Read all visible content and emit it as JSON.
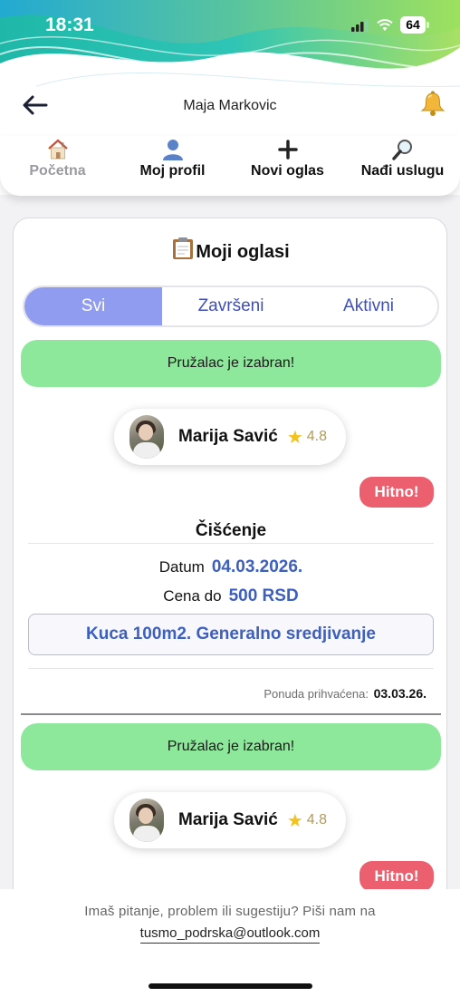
{
  "status_bar": {
    "time": "18:31",
    "battery": "64"
  },
  "header": {
    "user_name": "Maja Markovic"
  },
  "nav": {
    "items": [
      {
        "label": "Početna",
        "icon": "house-icon"
      },
      {
        "label": "Moj profil",
        "icon": "person-icon"
      },
      {
        "label": "Novi oglas",
        "icon": "plus-icon"
      },
      {
        "label": "Nađi uslugu",
        "icon": "magnifier-icon"
      }
    ]
  },
  "card": {
    "title": "Moji oglasi",
    "tabs": [
      {
        "label": "Svi",
        "active": true
      },
      {
        "label": "Završeni",
        "active": false
      },
      {
        "label": "Aktivni",
        "active": false
      }
    ],
    "listings": [
      {
        "status": "Pružalac je izabran!",
        "provider": {
          "name": "Marija Savić",
          "rating": "4.8"
        },
        "urgent": "Hitno!",
        "service": "Čišćenje",
        "date_label": "Datum",
        "date": "04.03.2026.",
        "price_label": "Cena do",
        "price": "500 RSD",
        "description": "Kuca 100m2. Generalno sredjivanje",
        "accepted_label": "Ponuda prihvaćena:",
        "accepted_date": "03.03.26."
      },
      {
        "status": "Pružalac je izabran!",
        "provider": {
          "name": "Marija Savić",
          "rating": "4.8"
        },
        "urgent": "Hitno!"
      }
    ]
  },
  "footer": {
    "text": "Imaš pitanje, problem ili sugestiju? Piši nam na",
    "email": "tusmo_podrska@outlook.com"
  },
  "colors": {
    "accent": "#8f9cf0",
    "tab_text": "#3f4fb5",
    "status_green": "#8ee89b",
    "urgent_red": "#ec5f6e",
    "value_blue": "#3d5fbe"
  }
}
